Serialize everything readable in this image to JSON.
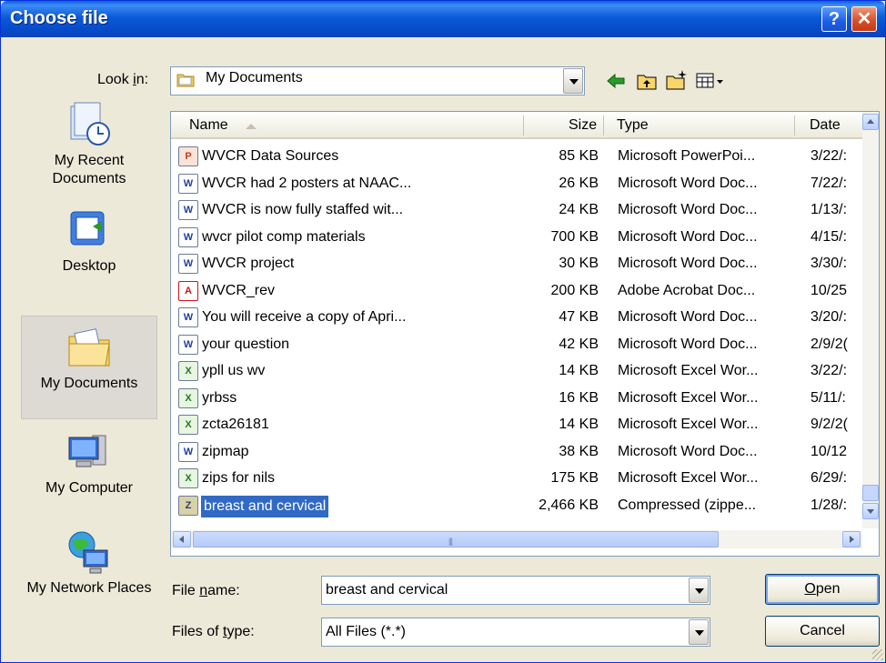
{
  "window": {
    "title": "Choose file",
    "help_label": "?",
    "close_label": "✕"
  },
  "look_in": {
    "label_prefix": "Look ",
    "label_accel": "i",
    "label_suffix": "n:",
    "value": "My Documents"
  },
  "nav_icons": [
    "back-icon",
    "up-folder-icon",
    "new-folder-icon",
    "view-menu-icon"
  ],
  "places": [
    {
      "label": "My Recent Documents",
      "icon": "recent-documents-icon"
    },
    {
      "label": "Desktop",
      "icon": "desktop-icon"
    },
    {
      "label": "My Documents",
      "icon": "my-documents-icon",
      "selected": true
    },
    {
      "label": "My Computer",
      "icon": "my-computer-icon"
    },
    {
      "label": "My Network Places",
      "icon": "network-places-icon"
    }
  ],
  "columns": {
    "name": "Name",
    "size": "Size",
    "type": "Type",
    "date": "Date"
  },
  "files": [
    {
      "name": "WVCR Data Sources",
      "size": "85 KB",
      "type": "Microsoft PowerPoi...",
      "date": "3/22/:",
      "kind": "ppt"
    },
    {
      "name": "WVCR had 2 posters at NAAC...",
      "size": "26 KB",
      "type": "Microsoft Word Doc...",
      "date": "7/22/:",
      "kind": "word"
    },
    {
      "name": "WVCR is now fully staffed wit...",
      "size": "24 KB",
      "type": "Microsoft Word Doc...",
      "date": "1/13/:",
      "kind": "word"
    },
    {
      "name": "wvcr pilot comp materials",
      "size": "700 KB",
      "type": "Microsoft Word Doc...",
      "date": "4/15/:",
      "kind": "word"
    },
    {
      "name": "WVCR project",
      "size": "30 KB",
      "type": "Microsoft Word Doc...",
      "date": "3/30/:",
      "kind": "word"
    },
    {
      "name": "WVCR_rev",
      "size": "200 KB",
      "type": "Adobe Acrobat Doc...",
      "date": "10/25",
      "kind": "pdf"
    },
    {
      "name": "You will receive a copy of Apri...",
      "size": "47 KB",
      "type": "Microsoft Word Doc...",
      "date": "3/20/:",
      "kind": "word"
    },
    {
      "name": "your question",
      "size": "42 KB",
      "type": "Microsoft Word Doc...",
      "date": "2/9/2(",
      "kind": "word"
    },
    {
      "name": "ypll us wv",
      "size": "14 KB",
      "type": "Microsoft Excel Wor...",
      "date": "3/22/:",
      "kind": "excel"
    },
    {
      "name": "yrbss",
      "size": "16 KB",
      "type": "Microsoft Excel Wor...",
      "date": "5/11/:",
      "kind": "excel"
    },
    {
      "name": "zcta26181",
      "size": "14 KB",
      "type": "Microsoft Excel Wor...",
      "date": "9/2/2(",
      "kind": "excel"
    },
    {
      "name": "zipmap",
      "size": "38 KB",
      "type": "Microsoft Word Doc...",
      "date": "10/12",
      "kind": "word"
    },
    {
      "name": "zips for nils",
      "size": "175 KB",
      "type": "Microsoft Excel Wor...",
      "date": "6/29/:",
      "kind": "excel"
    },
    {
      "name": "breast and cervical",
      "size": "2,466 KB",
      "type": "Compressed (zippe...",
      "date": "1/28/:",
      "kind": "zip",
      "selected": true
    }
  ],
  "file_name": {
    "label_prefix": "File ",
    "label_accel": "n",
    "label_suffix": "ame:",
    "value": "breast and cervical"
  },
  "file_type": {
    "label_prefix": "Files of ",
    "label_accel": "t",
    "label_suffix": "ype:",
    "value": "All Files (*.*)"
  },
  "buttons": {
    "open_accel": "O",
    "open_rest": "pen",
    "cancel": "Cancel"
  },
  "colors": {
    "titlebar": "#0a5fe0",
    "selection": "#316ac5",
    "dialog_bg": "#ece9d8"
  }
}
